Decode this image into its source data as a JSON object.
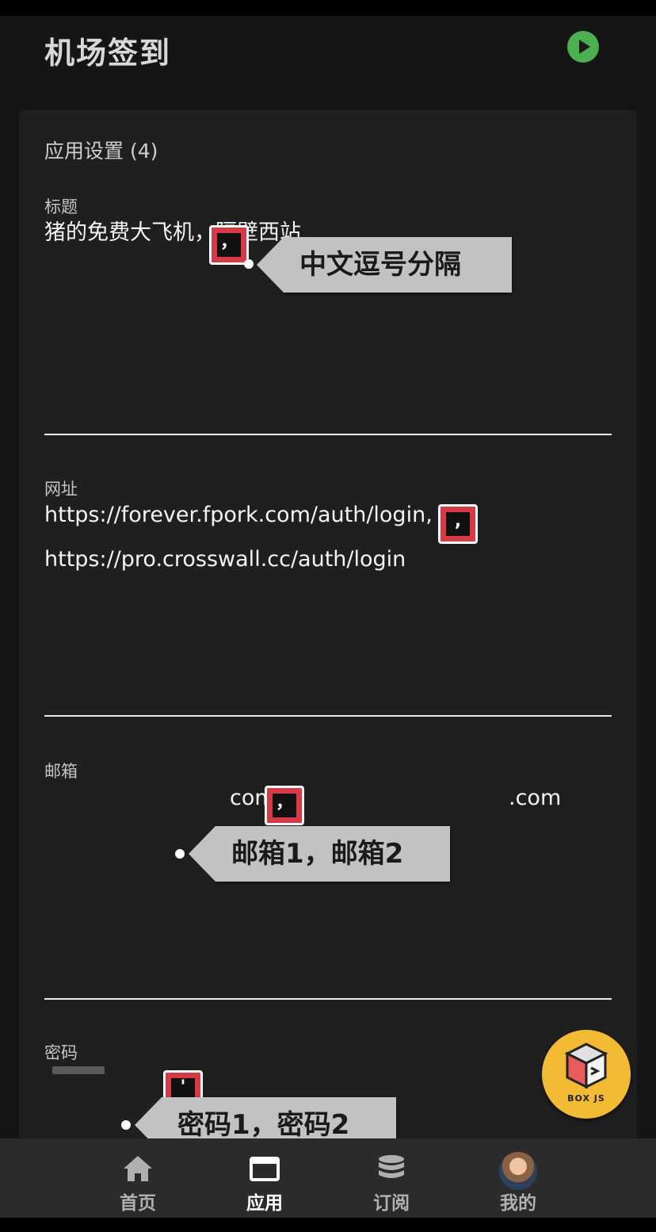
{
  "header": {
    "title": "机场签到"
  },
  "settings": {
    "section_title": "应用设置 (4)",
    "fields": [
      {
        "label": "标题",
        "lines": [
          "猪的免费大飞机，隔壁西站"
        ]
      },
      {
        "label": "网址",
        "lines": [
          "https://forever.fpork.com/auth/login,",
          "https://pro.crosswall.cc/auth/login"
        ]
      },
      {
        "label": "邮箱",
        "lines": [
          "com,",
          ".com"
        ]
      },
      {
        "label": "密码",
        "lines": []
      }
    ]
  },
  "annotations": {
    "marker_symbol": "，",
    "marker_symbol_plain": ",",
    "marker_symbol_pwd": "'",
    "tooltip_title": "中文逗号分隔",
    "tooltip_email": "邮箱1，邮箱2",
    "tooltip_password": "密码1，密码2"
  },
  "fab": {
    "label": "BOX JS"
  },
  "bottom_nav": [
    {
      "label": "首页",
      "icon": "home-icon",
      "active": false
    },
    {
      "label": "应用",
      "icon": "app-window-icon",
      "active": true
    },
    {
      "label": "订阅",
      "icon": "database-icon",
      "active": false
    },
    {
      "label": "我的",
      "icon": "avatar",
      "active": false
    }
  ],
  "colors": {
    "background": "#151515",
    "card": "#1f1f1f",
    "accent_green": "#4caf50",
    "marker_red": "#d63a44",
    "fab_yellow": "#f2bb33",
    "nav_bg": "#2b2b2b"
  }
}
